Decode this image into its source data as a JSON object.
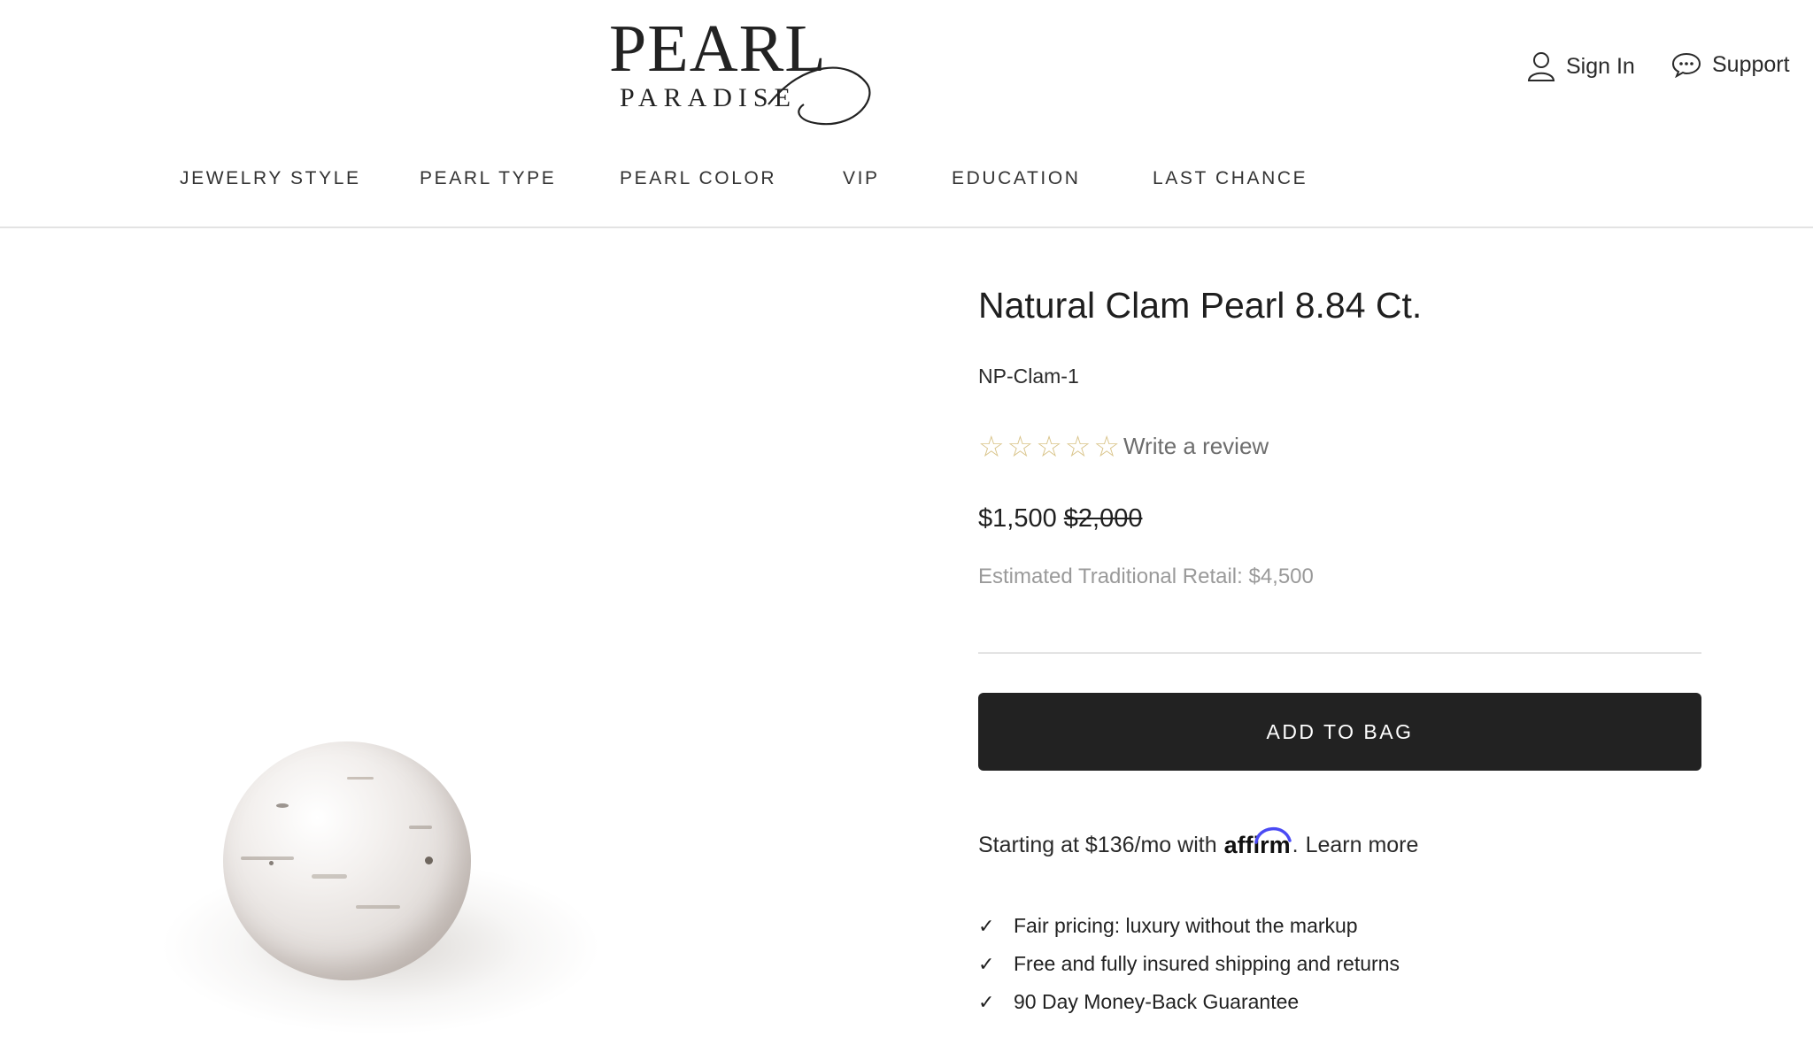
{
  "header": {
    "logo": {
      "line1": "PEARL",
      "line2": "PARADISE"
    },
    "util": {
      "sign_in": "Sign In",
      "support": "Support"
    },
    "nav": [
      "JEWELRY STYLE",
      "PEARL TYPE",
      "PEARL COLOR",
      "VIP",
      "EDUCATION",
      "LAST CHANCE"
    ]
  },
  "product": {
    "title": "Natural Clam Pearl 8.84 Ct.",
    "sku": "NP-Clam-1",
    "rating": {
      "stars_filled": 0,
      "stars_total": 5,
      "review_label": "Write a review"
    },
    "price": "$1,500",
    "compare_at_price": "$2,000",
    "retail_text": "Estimated Traditional Retail: $4,500",
    "add_to_bag_label": "ADD TO BAG",
    "financing": {
      "prefix": "Starting at $136/mo with",
      "brand": "affirm",
      "suffix": ".",
      "link": "Learn more"
    },
    "benefits": [
      "Fair pricing: luxury without the markup",
      "Free and fully insured shipping and returns",
      "90 Day Money-Back Guarantee"
    ]
  },
  "colors": {
    "button_bg": "#222222",
    "star_outline": "#d9c48a",
    "muted_text": "#9a9a9a",
    "affirm_arc": "#4a4af4"
  },
  "icons": {
    "sign_in": "user-icon",
    "support": "chat-bubble-icon",
    "rating": "star-outline-icon",
    "benefit": "checkmark-icon"
  }
}
